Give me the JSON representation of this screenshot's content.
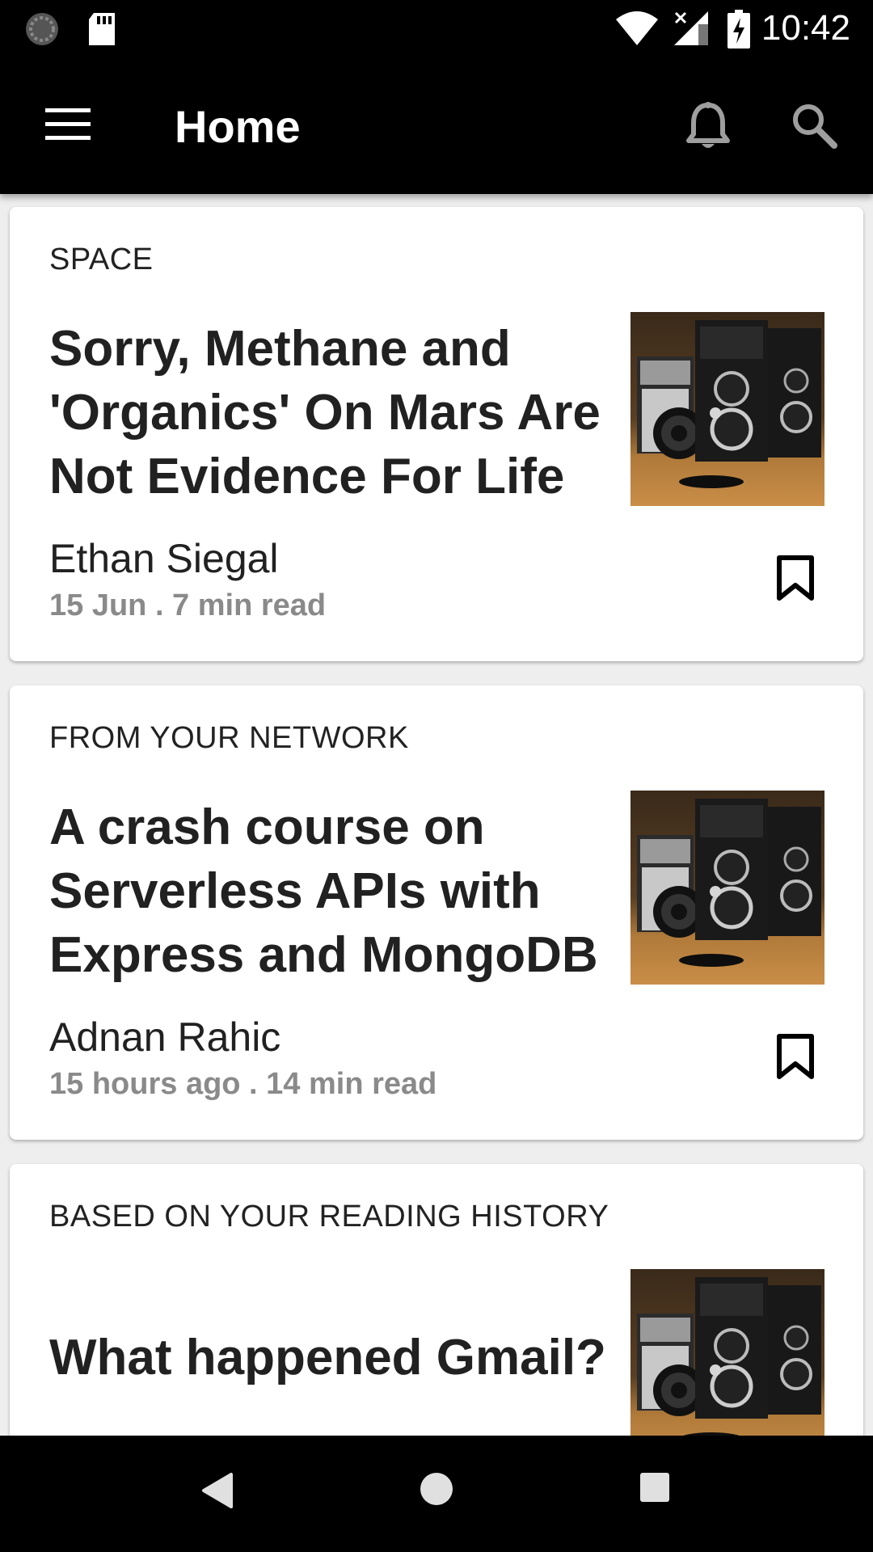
{
  "status_bar": {
    "time": "10:42",
    "icons": [
      "sync-icon",
      "sd-card-icon",
      "wifi-icon",
      "cell-signal-icon",
      "battery-charging-icon"
    ]
  },
  "app_bar": {
    "title": "Home",
    "icons": [
      "menu-icon",
      "notifications-bell-icon",
      "search-icon"
    ]
  },
  "feed": {
    "cards": [
      {
        "category": "SPACE",
        "headline": "Sorry, Methane and 'Organics' On Mars Are Not Evidence For Life",
        "author": "Ethan Siegal",
        "meta": "15 Jun . 7 min read"
      },
      {
        "category": "FROM YOUR NETWORK",
        "headline": "A crash course on Serverless APIs with Express and MongoDB",
        "author": "Adnan Rahic",
        "meta": "15 hours ago . 14 min read"
      },
      {
        "category": "BASED ON YOUR READING HISTORY",
        "headline": "What happened Gmail?"
      }
    ]
  },
  "nav_bar": {
    "icons": [
      "back-icon",
      "home-icon",
      "recents-icon"
    ]
  },
  "colors": {
    "bar_background": "#000000",
    "card_background": "#ffffff",
    "headline_text": "#212121",
    "meta_text": "#8a8a8a"
  }
}
